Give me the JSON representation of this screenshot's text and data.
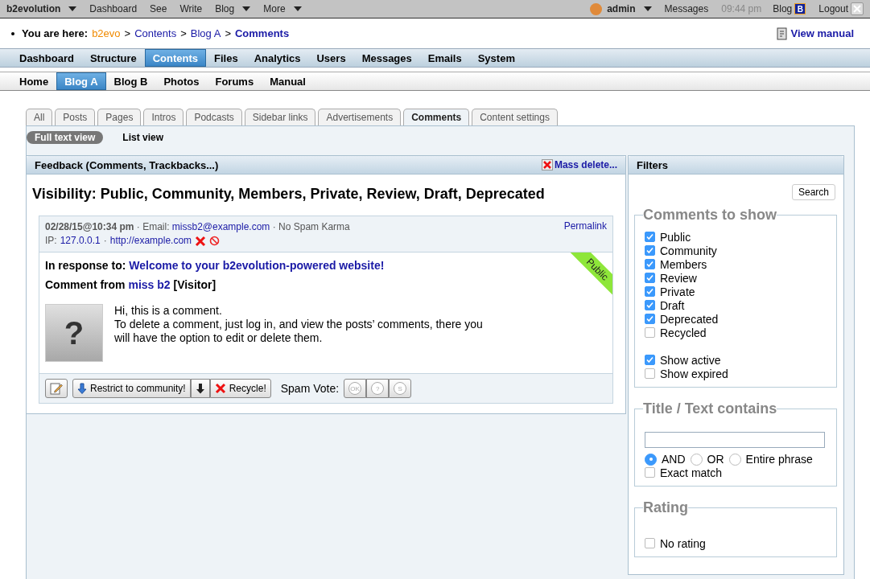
{
  "top_bar": {
    "items": [
      {
        "label": "b2evolution",
        "dropdown": true,
        "bold": true
      },
      {
        "label": "Dashboard",
        "dropdown": false,
        "bold": false
      },
      {
        "label": "See",
        "dropdown": false,
        "bold": false
      },
      {
        "label": "Write",
        "dropdown": false,
        "bold": false
      },
      {
        "label": "Blog",
        "dropdown": true,
        "bold": false
      },
      {
        "label": "More",
        "dropdown": true,
        "bold": false
      }
    ],
    "user": "admin",
    "messages": "Messages",
    "time": "09:44 pm",
    "blog": "Blog",
    "blog_badge": "B",
    "logout": "Logout"
  },
  "breadcrumb": {
    "label": "You are here:",
    "separator": ">",
    "items": [
      {
        "label": "b2evo",
        "kind": "site"
      },
      {
        "label": "Contents",
        "kind": "link"
      },
      {
        "label": "Blog A",
        "kind": "link"
      },
      {
        "label": "Comments",
        "kind": "current"
      }
    ]
  },
  "view_manual": "View manual",
  "main_menu": [
    {
      "label": "Dashboard",
      "selected": false
    },
    {
      "label": "Structure",
      "selected": false
    },
    {
      "label": "Contents",
      "selected": true
    },
    {
      "label": "Files",
      "selected": false
    },
    {
      "label": "Analytics",
      "selected": false
    },
    {
      "label": "Users",
      "selected": false
    },
    {
      "label": "Messages",
      "selected": false
    },
    {
      "label": "Emails",
      "selected": false
    },
    {
      "label": "System",
      "selected": false
    }
  ],
  "sub_menu": [
    {
      "label": "Home",
      "selected": false
    },
    {
      "label": "Blog A",
      "selected": true
    },
    {
      "label": "Blog B",
      "selected": false
    },
    {
      "label": "Photos",
      "selected": false
    },
    {
      "label": "Forums",
      "selected": false
    },
    {
      "label": "Manual",
      "selected": false
    }
  ],
  "tabs": [
    {
      "label": "All",
      "selected": false
    },
    {
      "label": "Posts",
      "selected": false
    },
    {
      "label": "Pages",
      "selected": false
    },
    {
      "label": "Intros",
      "selected": false
    },
    {
      "label": "Podcasts",
      "selected": false
    },
    {
      "label": "Sidebar links",
      "selected": false
    },
    {
      "label": "Advertisements",
      "selected": false
    },
    {
      "label": "Comments",
      "selected": true
    },
    {
      "label": "Content settings",
      "selected": false
    }
  ],
  "view_toggles": [
    {
      "label": "Full text view",
      "selected": true
    },
    {
      "label": "List view",
      "selected": false
    }
  ],
  "feedback": {
    "title": "Feedback (Comments, Trackbacks...)",
    "mass_delete": "Mass delete...",
    "visibility": "Visibility: Public, Community, Members, Private, Review, Draft, Deprecated",
    "comment": {
      "date": "02/28/15@10:34 pm",
      "dot": "·",
      "email_label": "Email:",
      "email": "missb2@example.com",
      "karma": "No Spam Karma",
      "ip_label": "IP:",
      "ip": "127.0.0.1",
      "url": "http://example.com",
      "permalink": "Permalink",
      "response_label": "In response to:",
      "response_link": "Welcome to your b2evolution-powered website!",
      "from_label": "Comment from",
      "author": "miss b2",
      "role": "[Visitor]",
      "status": "Public",
      "avatar_glyph": "?",
      "paragraphs": [
        "Hi, this is a comment.",
        "To delete a comment, just log in, and view the posts’ comments, there you will have the option to edit or delete them."
      ],
      "restrict": "Restrict to community!",
      "recycle": "Recycle!",
      "spam_vote_label": "Spam Vote:",
      "spam_votes": [
        "OK",
        "?",
        "S"
      ]
    }
  },
  "filters": {
    "title": "Filters",
    "search": "Search",
    "comments_to_show": {
      "legend": "Comments to show",
      "groups": [
        [
          {
            "label": "Public",
            "checked": true
          },
          {
            "label": "Community",
            "checked": true
          },
          {
            "label": "Members",
            "checked": true
          },
          {
            "label": "Review",
            "checked": true
          },
          {
            "label": "Private",
            "checked": true
          },
          {
            "label": "Draft",
            "checked": true
          },
          {
            "label": "Deprecated",
            "checked": true
          },
          {
            "label": "Recycled",
            "checked": false
          }
        ],
        [
          {
            "label": "Show active",
            "checked": true
          },
          {
            "label": "Show expired",
            "checked": false
          }
        ]
      ]
    },
    "text_contains": {
      "legend": "Title / Text contains",
      "modes": [
        {
          "label": "AND",
          "selected": true
        },
        {
          "label": "OR",
          "selected": false
        },
        {
          "label": "Entire phrase",
          "selected": false
        }
      ],
      "exact_match": {
        "label": "Exact match",
        "checked": false
      }
    },
    "rating": {
      "legend": "Rating",
      "options": [
        {
          "label": "No rating",
          "checked": false
        }
      ]
    }
  }
}
